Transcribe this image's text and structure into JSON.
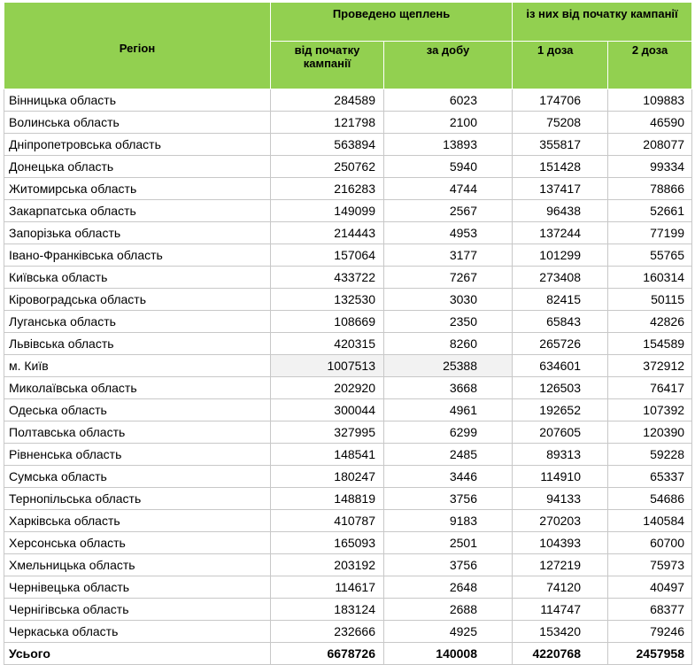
{
  "header": {
    "region": "Регіон",
    "vaccinated": "Проведено щеплень",
    "of_which": "із них від початку кампанії",
    "since_start": "від початку кампанії",
    "per_day": "за добу",
    "dose1": "1 доза",
    "dose2": "2 доза"
  },
  "rows": [
    {
      "region": "Вінницька область",
      "since_start": "284589",
      "per_day": "6023",
      "dose1": "174706",
      "dose2": "109883"
    },
    {
      "region": "Волинська область",
      "since_start": "121798",
      "per_day": "2100",
      "dose1": "75208",
      "dose2": "46590"
    },
    {
      "region": "Дніпропетровська область",
      "since_start": "563894",
      "per_day": "13893",
      "dose1": "355817",
      "dose2": "208077"
    },
    {
      "region": "Донецька область",
      "since_start": "250762",
      "per_day": "5940",
      "dose1": "151428",
      "dose2": "99334"
    },
    {
      "region": "Житомирська область",
      "since_start": "216283",
      "per_day": "4744",
      "dose1": "137417",
      "dose2": "78866"
    },
    {
      "region": "Закарпатська область",
      "since_start": "149099",
      "per_day": "2567",
      "dose1": "96438",
      "dose2": "52661"
    },
    {
      "region": "Запорізька область",
      "since_start": "214443",
      "per_day": "4953",
      "dose1": "137244",
      "dose2": "77199"
    },
    {
      "region": "Івано-Франківська область",
      "since_start": "157064",
      "per_day": "3177",
      "dose1": "101299",
      "dose2": "55765"
    },
    {
      "region": "Київська область",
      "since_start": "433722",
      "per_day": "7267",
      "dose1": "273408",
      "dose2": "160314"
    },
    {
      "region": "Кіровоградська область",
      "since_start": "132530",
      "per_day": "3030",
      "dose1": "82415",
      "dose2": "50115"
    },
    {
      "region": "Луганська область",
      "since_start": "108669",
      "per_day": "2350",
      "dose1": "65843",
      "dose2": "42826"
    },
    {
      "region": "Львівська область",
      "since_start": "420315",
      "per_day": "8260",
      "dose1": "265726",
      "dose2": "154589"
    },
    {
      "region": "м. Київ",
      "since_start": "1007513",
      "per_day": "25388",
      "dose1": "634601",
      "dose2": "372912"
    },
    {
      "region": "Миколаївська область",
      "since_start": "202920",
      "per_day": "3668",
      "dose1": "126503",
      "dose2": "76417"
    },
    {
      "region": "Одеська область",
      "since_start": "300044",
      "per_day": "4961",
      "dose1": "192652",
      "dose2": "107392"
    },
    {
      "region": "Полтавська область",
      "since_start": "327995",
      "per_day": "6299",
      "dose1": "207605",
      "dose2": "120390"
    },
    {
      "region": "Рівненська область",
      "since_start": "148541",
      "per_day": "2485",
      "dose1": "89313",
      "dose2": "59228"
    },
    {
      "region": "Сумська область",
      "since_start": "180247",
      "per_day": "3446",
      "dose1": "114910",
      "dose2": "65337"
    },
    {
      "region": "Тернопільська область",
      "since_start": "148819",
      "per_day": "3756",
      "dose1": "94133",
      "dose2": "54686"
    },
    {
      "region": "Харківська область",
      "since_start": "410787",
      "per_day": "9183",
      "dose1": "270203",
      "dose2": "140584"
    },
    {
      "region": "Херсонська область",
      "since_start": "165093",
      "per_day": "2501",
      "dose1": "104393",
      "dose2": "60700"
    },
    {
      "region": "Хмельницька область",
      "since_start": "203192",
      "per_day": "3756",
      "dose1": "127219",
      "dose2": "75973"
    },
    {
      "region": "Чернівецька область",
      "since_start": "114617",
      "per_day": "2648",
      "dose1": "74120",
      "dose2": "40497"
    },
    {
      "region": "Чернігівська область",
      "since_start": "183124",
      "per_day": "2688",
      "dose1": "114747",
      "dose2": "68377"
    },
    {
      "region": "Черкаська область",
      "since_start": "232666",
      "per_day": "4925",
      "dose1": "153420",
      "dose2": "79246"
    }
  ],
  "total": {
    "region": "Усього",
    "since_start": "6678726",
    "per_day": "140008",
    "dose1": "4220768",
    "dose2": "2457958"
  },
  "colors": {
    "header_bg": "#92d050",
    "highlight_bg": "#f2f2f2",
    "grid": "#c8c8c8"
  }
}
